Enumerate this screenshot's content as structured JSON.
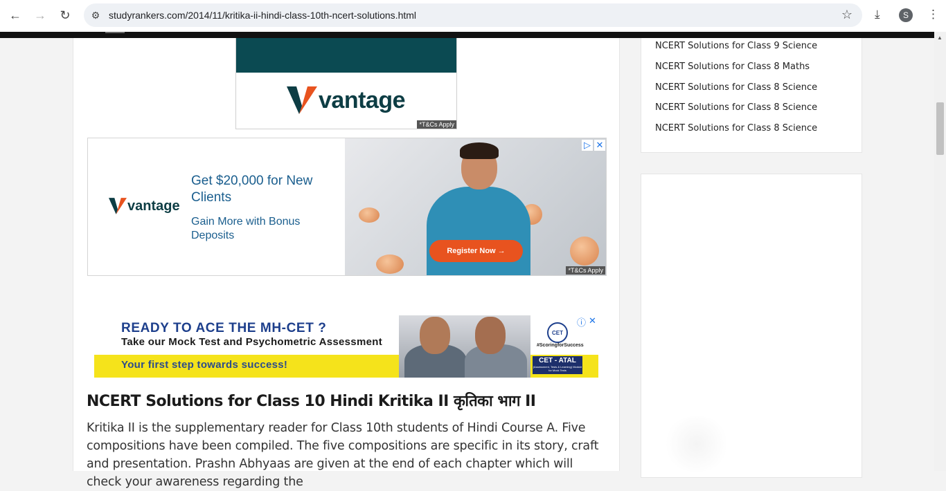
{
  "browser": {
    "url": "studyrankers.com/2014/11/kritika-ii-hindi-class-10th-ncert-solutions.html",
    "profile_initial": "S"
  },
  "ads": {
    "vantage_top": {
      "brand": "vantage",
      "tc": "*T&Cs Apply"
    },
    "vantage_banner": {
      "brand": "vantage",
      "headline": "Get $20,000 for New Clients",
      "subline": "Gain More with Bonus Deposits",
      "cta": "Register Now →",
      "tc": "*T&Cs Apply"
    },
    "mhcet": {
      "headline": "READY TO ACE THE MH-CET ?",
      "subhead": "Take our Mock Test and Psychometric Assessment",
      "tagline": "Your first step towards success!",
      "seal": "CET",
      "hashtag": "#ScoringforSuccess",
      "badge_title": "CET - ATAL",
      "badge_sub": "(Assessment, Tests & Learning) Module for Mock Tests"
    }
  },
  "article": {
    "title": "NCERT Solutions for Class 10 Hindi Kritika II कृतिका भाग II",
    "body": "Kritika II is the supplementary reader for Class 10th students of Hindi Course A. Five compositions have been compiled. The five compositions are specific in its story, craft and presentation. Prashn Abhyaas are given at the end of each chapter which will check your awareness regarding the"
  },
  "sidebar": {
    "links": [
      "NCERT Solutions for Class 9 Science",
      "NCERT Solutions for Class 8 Maths",
      "NCERT Solutions for Class 8 Science",
      "NCERT Solutions for Class 8 Science",
      "NCERT Solutions for Class 8 Science"
    ]
  },
  "colors": {
    "vantage_teal": "#0b4a52",
    "vantage_orange": "#e8531f",
    "ad_blue": "#1a5e8e",
    "mhcet_yellow": "#f5e31b",
    "mhcet_navy": "#1d3f8c"
  }
}
